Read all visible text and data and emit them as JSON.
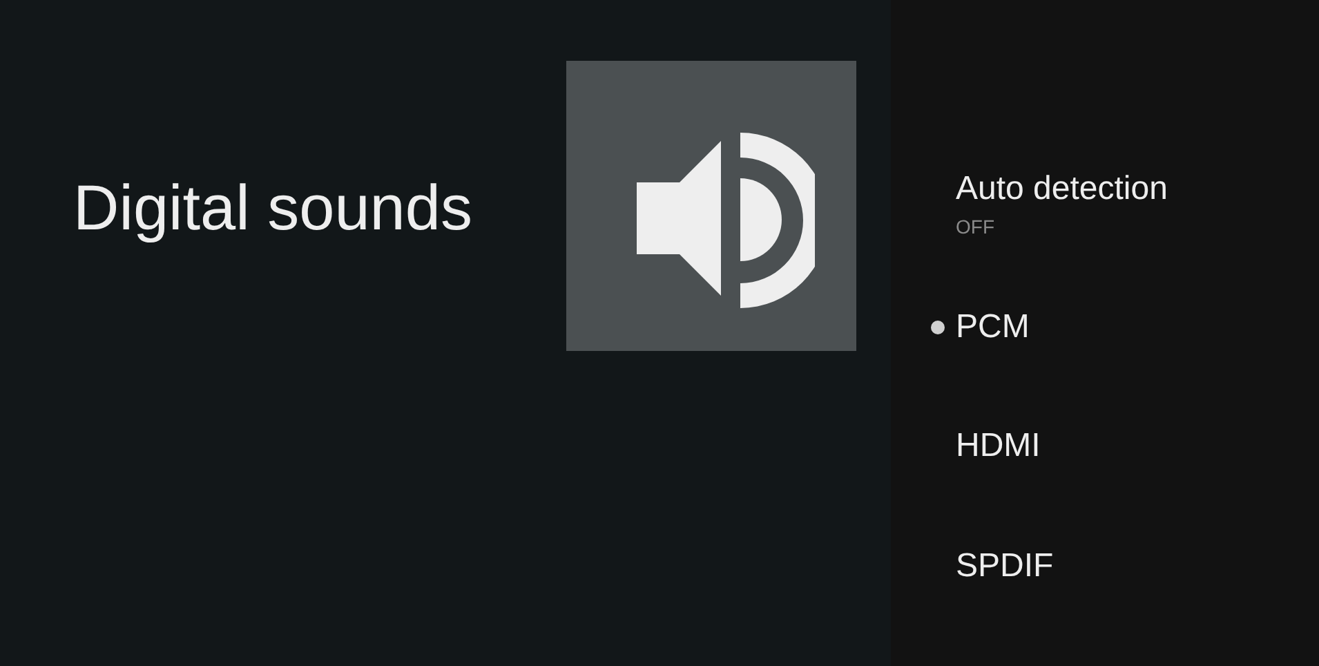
{
  "title": "Digital sounds",
  "items": [
    {
      "kind": "toggle",
      "label": "Auto detection",
      "value": "OFF"
    },
    {
      "kind": "option",
      "label": "PCM",
      "selected": true
    },
    {
      "kind": "option",
      "label": "HDMI",
      "selected": false
    },
    {
      "kind": "option",
      "label": "SPDIF",
      "selected": false
    }
  ]
}
